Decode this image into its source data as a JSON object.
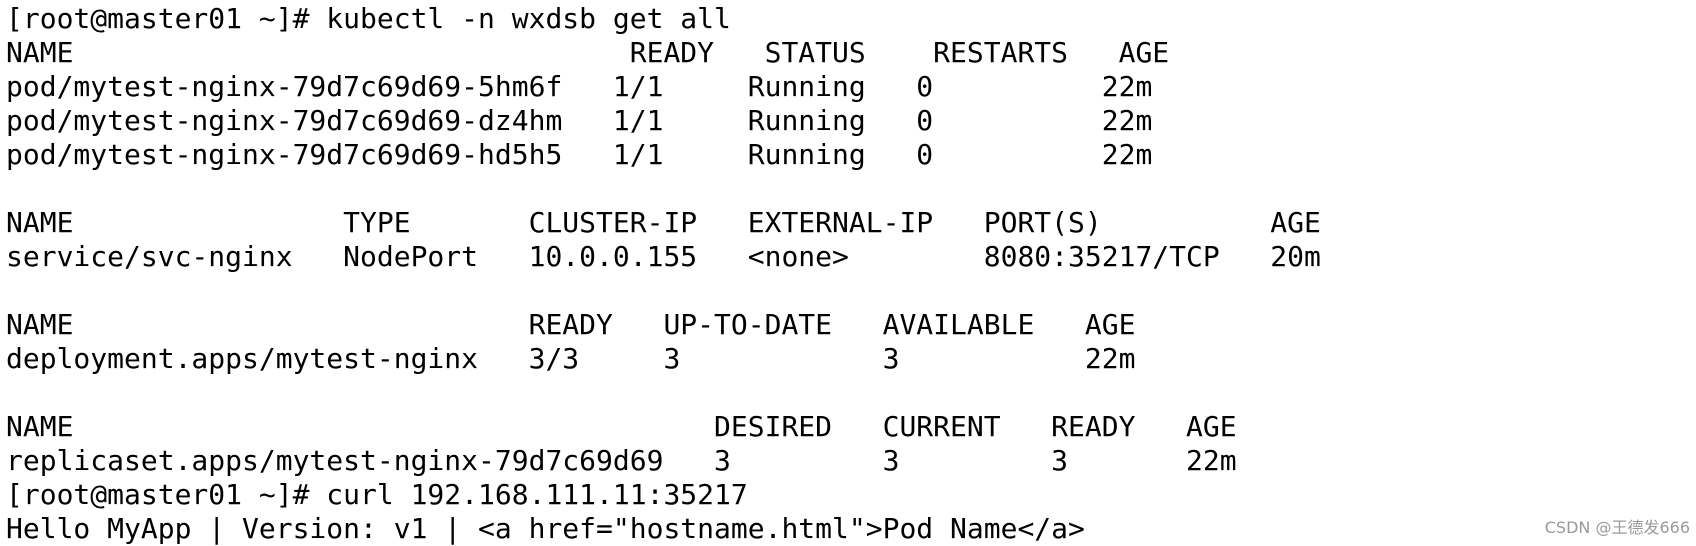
{
  "terminal": {
    "lines": [
      "[root@master01 ~]# kubectl -n wxdsb get all",
      "NAME                                 READY   STATUS    RESTARTS   AGE",
      "pod/mytest-nginx-79d7c69d69-5hm6f   1/1     Running   0          22m",
      "pod/mytest-nginx-79d7c69d69-dz4hm   1/1     Running   0          22m",
      "pod/mytest-nginx-79d7c69d69-hd5h5   1/1     Running   0          22m",
      "",
      "NAME                TYPE       CLUSTER-IP   EXTERNAL-IP   PORT(S)          AGE",
      "service/svc-nginx   NodePort   10.0.0.155   <none>        8080:35217/TCP   20m",
      "",
      "NAME                           READY   UP-TO-DATE   AVAILABLE   AGE",
      "deployment.apps/mytest-nginx   3/3     3            3           22m",
      "",
      "NAME                                      DESIRED   CURRENT   READY   AGE",
      "replicaset.apps/mytest-nginx-79d7c69d69   3         3         3       22m",
      "[root@master01 ~]# curl 192.168.111.11:35217",
      "Hello MyApp | Version: v1 | <a href=\"hostname.html\">Pod Name</a>"
    ]
  },
  "watermark": "CSDN @王德发666"
}
